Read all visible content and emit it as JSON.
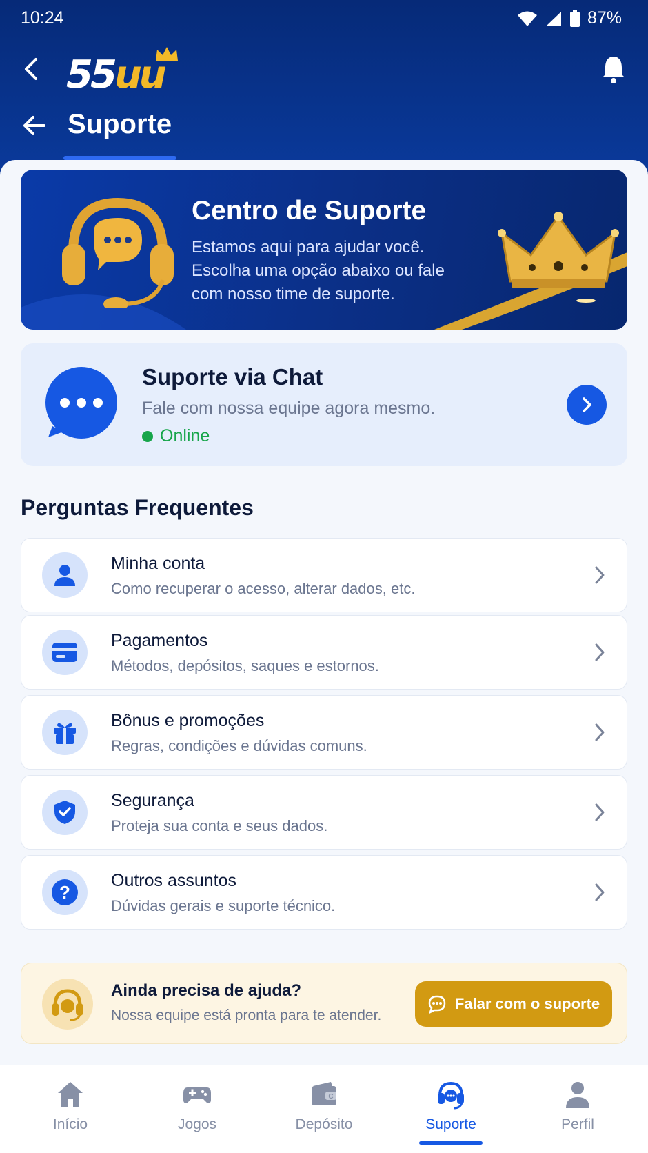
{
  "status_bar": {
    "time": "10:24",
    "battery": "87%"
  },
  "header": {
    "brand": "55uu",
    "brand_main": "55",
    "brand_accent": "uu",
    "title": "Suporte"
  },
  "hero": {
    "title": "Centro de Suporte",
    "description": "Estamos aqui para ajudar você. Escolha uma opção abaixo ou fale com nosso time de suporte."
  },
  "chat": {
    "title": "Suporte via Chat",
    "subtitle": "Fale com nossa equipe agora mesmo.",
    "status": "Online"
  },
  "faq": {
    "heading": "Perguntas Frequentes",
    "items": [
      {
        "title": "Minha conta",
        "subtitle": "Como recuperar o acesso, alterar dados, etc.",
        "icon": "user-icon"
      },
      {
        "title": "Pagamentos",
        "subtitle": "Métodos, depósitos, saques e estornos.",
        "icon": "card-icon"
      },
      {
        "title": "Bônus e promoções",
        "subtitle": "Regras, condições e dúvidas comuns.",
        "icon": "gift-icon"
      },
      {
        "title": "Segurança",
        "subtitle": "Proteja sua conta e seus dados.",
        "icon": "shield-icon"
      },
      {
        "title": "Outros assuntos",
        "subtitle": "Dúvidas gerais e suporte técnico.",
        "icon": "question-icon"
      }
    ]
  },
  "help": {
    "title": "Ainda precisa de ajuda?",
    "subtitle": "Nossa equipe está pronta para te atender.",
    "button_label": "Falar com o suporte"
  },
  "bottom_nav": {
    "items": [
      {
        "label": "Início",
        "icon": "home-icon"
      },
      {
        "label": "Jogos",
        "icon": "gamepad-icon"
      },
      {
        "label": "Depósito",
        "icon": "wallet-icon"
      },
      {
        "label": "Suporte",
        "icon": "headset-icon"
      },
      {
        "label": "Perfil",
        "icon": "profile-icon"
      }
    ],
    "active": "Suporte"
  },
  "colors": {
    "primary": "#1658e3",
    "header": "#062a78",
    "gold": "#d29a12",
    "online": "#17a54a"
  }
}
